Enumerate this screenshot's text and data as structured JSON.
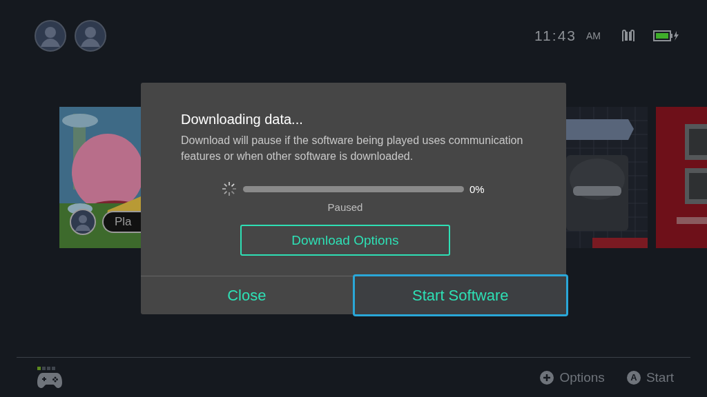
{
  "status_bar": {
    "users": [
      {
        "kind": "avatar"
      },
      {
        "kind": "avatar"
      }
    ],
    "time": "11:43",
    "meridiem": "AM"
  },
  "tiles": [
    {
      "kind": "landscape",
      "play_label": "Pla"
    },
    {
      "kind": "console"
    },
    {
      "kind": "red"
    }
  ],
  "dialog": {
    "title": "Downloading data...",
    "message": "Download will pause if the software being played uses communication features or when other software is downloaded.",
    "progress": {
      "level": 0,
      "reading": "0%",
      "status": "Paused"
    },
    "options_button": "Download Options",
    "buttons": [
      {
        "label": "Close",
        "selected": false
      },
      {
        "label": "Start Software",
        "selected": true
      }
    ]
  },
  "footer": {
    "players": [
      {
        "active": true
      },
      {
        "active": false
      },
      {
        "active": false
      },
      {
        "active": false
      }
    ],
    "hints": [
      {
        "kind": "plus",
        "label": "Options"
      },
      {
        "kind": "letter",
        "glyph": "A",
        "label": "Start"
      }
    ]
  }
}
